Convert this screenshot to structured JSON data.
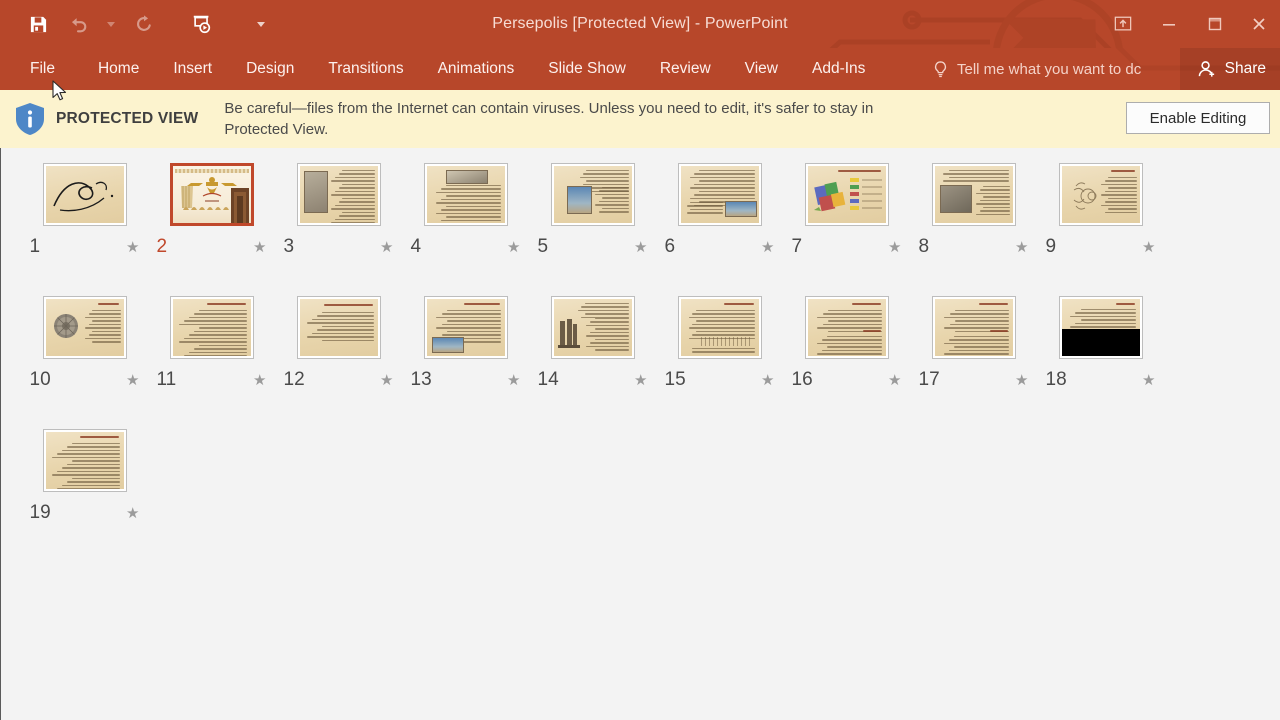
{
  "window": {
    "title": "Persepolis [Protected View] - PowerPoint",
    "accent_color": "#b7472a",
    "background_color": "#f3f3f3"
  },
  "quick_access_toolbar": {
    "items": [
      {
        "name": "save",
        "icon": "save-icon",
        "enabled": true
      },
      {
        "name": "undo",
        "icon": "undo-icon",
        "enabled": false
      },
      {
        "name": "undo-dropdown",
        "icon": "chevron-down-icon",
        "enabled": false
      },
      {
        "name": "redo",
        "icon": "redo-icon",
        "enabled": false
      },
      {
        "name": "start-from-beginning",
        "icon": "slideshow-icon",
        "enabled": true
      },
      {
        "name": "customize-quick-access-toolbar",
        "icon": "chevron-down-icon",
        "enabled": true
      }
    ]
  },
  "window_controls": {
    "ribbon_display_options": "ribbon-display-options-icon",
    "minimize": "minimize-icon",
    "restore": "restore-icon",
    "close": "close-icon"
  },
  "ribbon": {
    "tabs": [
      {
        "label": "File",
        "active": false
      },
      {
        "label": "Home",
        "active": false
      },
      {
        "label": "Insert",
        "active": false
      },
      {
        "label": "Design",
        "active": false
      },
      {
        "label": "Transitions",
        "active": false
      },
      {
        "label": "Animations",
        "active": false
      },
      {
        "label": "Slide Show",
        "active": false
      },
      {
        "label": "Review",
        "active": false
      },
      {
        "label": "View",
        "active": false
      },
      {
        "label": "Add-Ins",
        "active": false
      }
    ],
    "tell_me": "Tell me what you want to dc",
    "share_label": "Share"
  },
  "protected_view": {
    "badge": "PROTECTED VIEW",
    "message": "Be careful—files from the Internet can contain viruses. Unless you need to edit, it's safer to stay in Protected View.",
    "enable_editing": "Enable Editing",
    "bar_color": "#fcf3ce"
  },
  "slides": [
    {
      "number": "1",
      "star": "★",
      "selected": false,
      "layout": "calligraphy"
    },
    {
      "number": "2",
      "star": "★",
      "selected": true,
      "layout": "title-faravahar"
    },
    {
      "number": "3",
      "star": "★",
      "selected": false,
      "layout": "image-left-text"
    },
    {
      "number": "4",
      "star": "★",
      "selected": false,
      "layout": "image-top-text"
    },
    {
      "number": "5",
      "star": "★",
      "selected": false,
      "layout": "image-mid-text"
    },
    {
      "number": "6",
      "star": "★",
      "selected": false,
      "layout": "text-image-bottom-right"
    },
    {
      "number": "7",
      "star": "★",
      "selected": false,
      "layout": "chart-colorful"
    },
    {
      "number": "8",
      "star": "★",
      "selected": false,
      "layout": "artifact-photo-text"
    },
    {
      "number": "9",
      "star": "★",
      "selected": false,
      "layout": "relief-text"
    },
    {
      "number": "10",
      "star": "★",
      "selected": false,
      "layout": "rosette-text"
    },
    {
      "number": "11",
      "star": "★",
      "selected": false,
      "layout": "text-only"
    },
    {
      "number": "12",
      "star": "★",
      "selected": false,
      "layout": "text-only-sparse"
    },
    {
      "number": "13",
      "star": "★",
      "selected": false,
      "layout": "text-photo-bottom-left"
    },
    {
      "number": "14",
      "star": "★",
      "selected": false,
      "layout": "columns-photo-text"
    },
    {
      "number": "15",
      "star": "★",
      "selected": false,
      "layout": "text-wide-lines"
    },
    {
      "number": "16",
      "star": "★",
      "selected": false,
      "layout": "text-two-blocks"
    },
    {
      "number": "17",
      "star": "★",
      "selected": false,
      "layout": "text-two-blocks"
    },
    {
      "number": "18",
      "star": "★",
      "selected": false,
      "layout": "text-black-bar"
    },
    {
      "number": "19",
      "star": "★",
      "selected": false,
      "layout": "text-only"
    }
  ]
}
